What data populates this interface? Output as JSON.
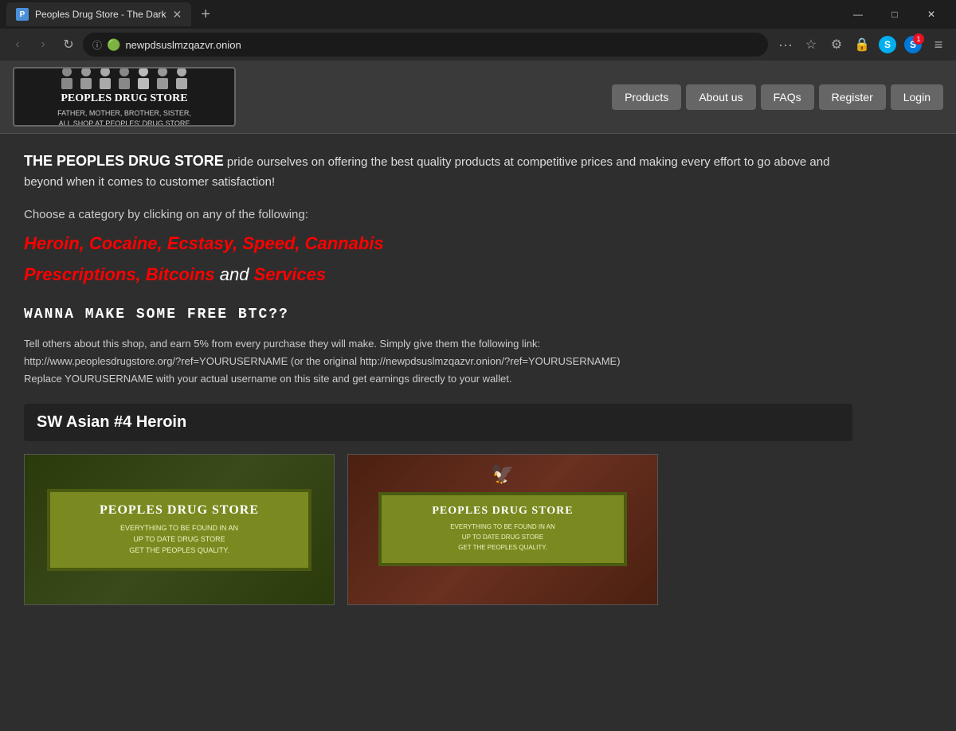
{
  "browser": {
    "tab_title": "Peoples Drug Store - The Dark",
    "tab_favicon": "P",
    "url": "newpdsuslmzqazvr.onion",
    "new_tab_icon": "+",
    "window_controls": {
      "minimize": "—",
      "maximize": "□",
      "close": "✕"
    },
    "nav": {
      "back": "‹",
      "forward": "›",
      "refresh": "↻",
      "more": "···",
      "bookmark": "☆",
      "shield1": "🛡",
      "shield2": "🔒",
      "skype_s": "S",
      "skype_s2": "S",
      "menu": "≡",
      "notification_count": "1"
    }
  },
  "header": {
    "logo_store_name": "PEOPLES DRUG STORE",
    "logo_tagline": "FATHER, MOTHER, BROTHER, SISTER,\nALL SHOP AT PEOPLES' DRUG STORE",
    "nav_items": [
      {
        "label": "Products"
      },
      {
        "label": "About us"
      },
      {
        "label": "FAQs"
      },
      {
        "label": "Register"
      },
      {
        "label": "Login"
      }
    ]
  },
  "main": {
    "intro_bold": "THE PEOPLES DRUG STORE",
    "intro_rest": " pride ourselves on offering the best quality products at competitive prices and making every effort to go above and beyond when it comes to customer satisfaction!",
    "category_intro": "Choose a category by clicking on any of the following:",
    "categories": [
      {
        "label": "Heroin",
        "comma": true
      },
      {
        "label": "Cocaine",
        "comma": true
      },
      {
        "label": "Ecstasy",
        "comma": true
      },
      {
        "label": "Speed",
        "comma": true
      },
      {
        "label": "Cannabis",
        "comma": false
      },
      {
        "label": "Prescriptions",
        "comma": true
      },
      {
        "label": "Bitcoins",
        "comma": false
      },
      {
        "label": "Services",
        "comma": false
      }
    ],
    "and_text": " and ",
    "btc_heading": "WANNA MAKE SOME FREE BTC??",
    "btc_text_1": "Tell others about this shop, and earn 5% from every purchase they will make. Simply give them the following link:",
    "btc_text_2": "http://www.peoplesdrugstore.org/?ref=YOURUSERNAME (or the original http://newpdsuslmzqazvr.onion/?ref=YOURUSERNAME)",
    "btc_text_3": "Replace YOURUSERNAME with your actual username on this site and get earnings directly to your wallet.",
    "product_section_title": "SW Asian #4 Heroin",
    "sign_title": "PEOPLES DRUG STORE",
    "sign_line1": "EVERYTHING TO BE FOUND IN AN",
    "sign_line2": "UP TO DATE DRUG STORE",
    "sign_line3": "GET THE PEOPLES QUALITY."
  }
}
